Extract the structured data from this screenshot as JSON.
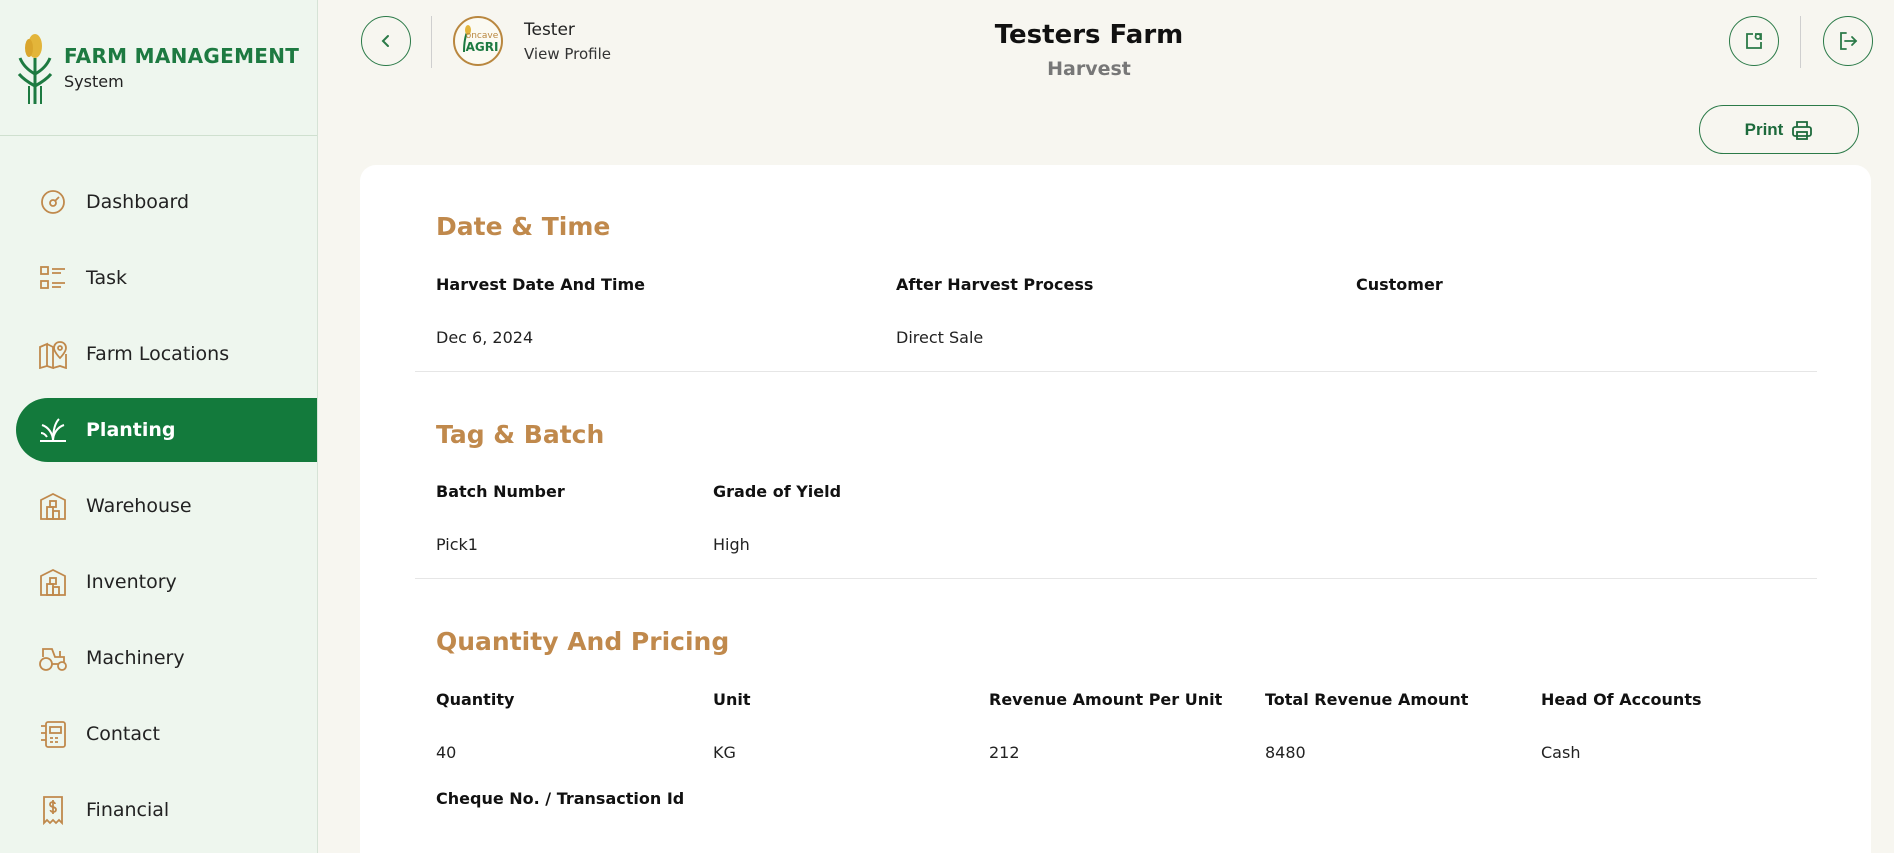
{
  "brand": {
    "title": "FARM MANAGEMENT",
    "subtitle": "System"
  },
  "sidebar": {
    "items": [
      {
        "label": "Dashboard",
        "icon": "dashboard-icon",
        "active": false
      },
      {
        "label": "Task",
        "icon": "task-list-icon",
        "active": false
      },
      {
        "label": "Farm Locations",
        "icon": "map-pin-icon",
        "active": false
      },
      {
        "label": "Planting",
        "icon": "plant-icon",
        "active": true
      },
      {
        "label": "Warehouse",
        "icon": "warehouse-icon",
        "active": false
      },
      {
        "label": "Inventory",
        "icon": "inventory-icon",
        "active": false
      },
      {
        "label": "Machinery",
        "icon": "tractor-icon",
        "active": false
      },
      {
        "label": "Contact",
        "icon": "contact-icon",
        "active": false
      },
      {
        "label": "Financial",
        "icon": "receipt-icon",
        "active": false
      }
    ]
  },
  "header": {
    "user_name": "Tester",
    "user_link": "View Profile",
    "farm_title": "Testers Farm",
    "page_subtitle": "Harvest",
    "avatar_text_top": "oncave",
    "avatar_text_bottom": "AGRI"
  },
  "toolbar": {
    "print_label": "Print"
  },
  "sections": {
    "date_time": {
      "title": "Date & Time",
      "fields": [
        {
          "label": "Harvest Date And Time",
          "value": "Dec 6, 2024"
        },
        {
          "label": "After Harvest Process",
          "value": "Direct Sale"
        },
        {
          "label": "Customer",
          "value": ""
        }
      ]
    },
    "tag_batch": {
      "title": "Tag & Batch",
      "fields": [
        {
          "label": "Batch Number",
          "value": "Pick1"
        },
        {
          "label": "Grade of Yield",
          "value": "High"
        }
      ]
    },
    "quantity_pricing": {
      "title": "Quantity And Pricing",
      "fields": [
        {
          "label": "Quantity",
          "value": "40"
        },
        {
          "label": "Unit",
          "value": "KG"
        },
        {
          "label": "Revenue Amount Per Unit",
          "value": "212"
        },
        {
          "label": "Total Revenue Amount",
          "value": "8480"
        },
        {
          "label": "Head Of Accounts",
          "value": "Cash"
        },
        {
          "label": "Cheque No. / Transaction Id",
          "value": ""
        }
      ]
    }
  },
  "colors": {
    "brand_green": "#137a3c",
    "accent_gold": "#c0894c",
    "background": "#f7f6f0"
  }
}
